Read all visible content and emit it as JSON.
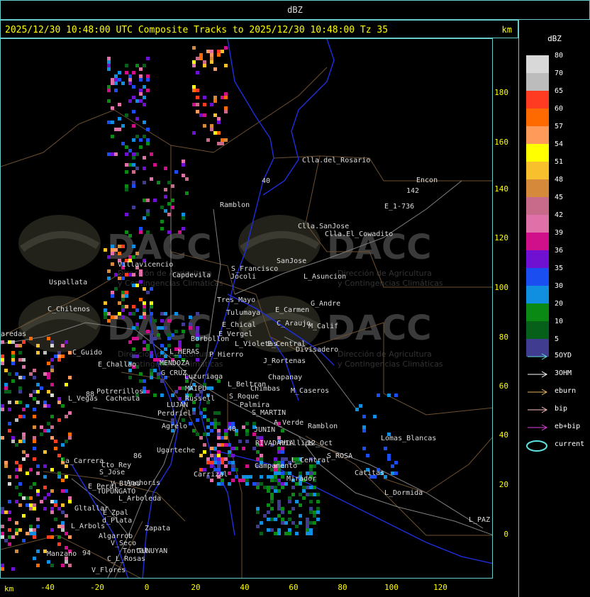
{
  "window": {
    "title": "dBZ"
  },
  "header": {
    "title": "2025/12/30 10:48:00 UTC Composite Tracks to 2025/12/30 10:48:00 Tz 35",
    "unit": "km"
  },
  "axes": {
    "x_unit": "km",
    "x_ticks": [
      "-40",
      "-20",
      "0",
      "20",
      "40",
      "60",
      "80",
      "100",
      "120"
    ],
    "y_ticks": [
      "180",
      "160",
      "140",
      "120",
      "100",
      "80",
      "60",
      "40",
      "20",
      "0"
    ]
  },
  "legend": {
    "caption": "dBZ",
    "scale": [
      {
        "label": "80",
        "color": "#d8d8d8"
      },
      {
        "label": "70",
        "color": "#bcbcbc"
      },
      {
        "label": "65",
        "color": "#ff3b22"
      },
      {
        "label": "60",
        "color": "#ff6a00"
      },
      {
        "label": "57",
        "color": "#ff9a5a"
      },
      {
        "label": "54",
        "color": "#ffff00"
      },
      {
        "label": "51",
        "color": "#f8c02c"
      },
      {
        "label": "48",
        "color": "#d48a3a"
      },
      {
        "label": "45",
        "color": "#c86a8a"
      },
      {
        "label": "42",
        "color": "#e070a8"
      },
      {
        "label": "39",
        "color": "#d0108a"
      },
      {
        "label": "36",
        "color": "#7010d0"
      },
      {
        "label": "35",
        "color": "#1a4ef0"
      },
      {
        "label": "30",
        "color": "#108ee0"
      },
      {
        "label": "20",
        "color": "#0a8a14"
      },
      {
        "label": "10",
        "color": "#06601a"
      },
      {
        "label": "5",
        "color": "#403c90"
      }
    ],
    "tracks": [
      {
        "label": "5OYD",
        "color": "#5fe0e0",
        "type": "arrow"
      },
      {
        "label": "3OHM",
        "color": "#ffffff",
        "type": "arrow"
      },
      {
        "label": "eburn",
        "color": "#e8b060",
        "type": "arrow"
      },
      {
        "label": "bip",
        "color": "#ffc0c0",
        "type": "arrow"
      },
      {
        "label": "eb+bip",
        "color": "#e040e0",
        "type": "arrow"
      },
      {
        "label": "current",
        "color": "#5fe0e0",
        "type": "ellipse"
      }
    ]
  },
  "watermark": {
    "text": "DACC",
    "subtitle_1": "Dirección de Agricultura",
    "subtitle_2": "y Contingencias Climáticas"
  },
  "places": [
    {
      "name": "Clla.del_Rosario"
    },
    {
      "name": "Encon"
    },
    {
      "name": "142"
    },
    {
      "name": "E_1-736"
    },
    {
      "name": "Ramblon"
    },
    {
      "name": "Clla.SanJose"
    },
    {
      "name": "Clla.El_Cowadito"
    },
    {
      "name": "S_Francisco"
    },
    {
      "name": "SanJose"
    },
    {
      "name": "Capdevila"
    },
    {
      "name": "L_Asuncion"
    },
    {
      "name": "Uspallata"
    },
    {
      "name": "Villavicencio"
    },
    {
      "name": "Jocoli"
    },
    {
      "name": "Tres_Mayo"
    },
    {
      "name": "G_Andre"
    },
    {
      "name": "Tulumaya"
    },
    {
      "name": "E_Carmen"
    },
    {
      "name": "C_Chilenos"
    },
    {
      "name": "E_Chical"
    },
    {
      "name": "C_Araujo"
    },
    {
      "name": "M_Calif"
    },
    {
      "name": "E_Vergel"
    },
    {
      "name": "Borbollon"
    },
    {
      "name": "L_Violetas"
    },
    {
      "name": "E_Central"
    },
    {
      "name": "aredas"
    },
    {
      "name": "Divisadero"
    },
    {
      "name": "L_HERAS"
    },
    {
      "name": "P_Hierro"
    },
    {
      "name": "C_Guido"
    },
    {
      "name": "MENDOZA"
    },
    {
      "name": "J_Rortenas"
    },
    {
      "name": "E_Challao"
    },
    {
      "name": "G_CRUZ"
    },
    {
      "name": "Chapanay"
    },
    {
      "name": "Luzuriaga"
    },
    {
      "name": "L_Beltran"
    },
    {
      "name": "MAIPU"
    },
    {
      "name": "Chimbas"
    },
    {
      "name": "M_Caseros"
    },
    {
      "name": "Potrerillos"
    },
    {
      "name": "Russell"
    },
    {
      "name": "S_Roque"
    },
    {
      "name": "L_Vegas"
    },
    {
      "name": "Cacheuta"
    },
    {
      "name": "LUJAN"
    },
    {
      "name": "Palmira"
    },
    {
      "name": "S_MARTIN"
    },
    {
      "name": "Perdriel"
    },
    {
      "name": "A_Verde"
    },
    {
      "name": "Ramblon"
    },
    {
      "name": "Agrelo"
    },
    {
      "name": "JUNIN"
    },
    {
      "name": "Ugarteche"
    },
    {
      "name": "RIVADAVIA"
    },
    {
      "name": "Phillips"
    },
    {
      "name": "12_Oct"
    },
    {
      "name": "Lomas_Blancas"
    },
    {
      "name": "La_Carrera"
    },
    {
      "name": "Cto_Rey"
    },
    {
      "name": "S_Jose"
    },
    {
      "name": "Carrizal"
    },
    {
      "name": "Campamento"
    },
    {
      "name": "L_Central"
    },
    {
      "name": "S_ROSA"
    },
    {
      "name": "Catitas"
    },
    {
      "name": "Anchoris"
    },
    {
      "name": "Mirador"
    },
    {
      "name": "E_Peral"
    },
    {
      "name": "TUPUNGATO"
    },
    {
      "name": "V_Btias"
    },
    {
      "name": "L_Dormida"
    },
    {
      "name": "L_Arboleda"
    },
    {
      "name": "Gltallar"
    },
    {
      "name": "E_Zpal"
    },
    {
      "name": "L_Arbols"
    },
    {
      "name": "d_Plata"
    },
    {
      "name": "Zapata"
    },
    {
      "name": "L_PAZ"
    },
    {
      "name": "Algarrob"
    },
    {
      "name": "V_Seco"
    },
    {
      "name": "Tontal"
    },
    {
      "name": "TUNUYAN"
    },
    {
      "name": "Manzano"
    },
    {
      "name": "C_L_Rosas"
    },
    {
      "name": "V_Flores"
    },
    {
      "name": "88"
    },
    {
      "name": "86"
    },
    {
      "name": "40"
    },
    {
      "name": "94"
    },
    {
      "name": "40"
    }
  ]
}
